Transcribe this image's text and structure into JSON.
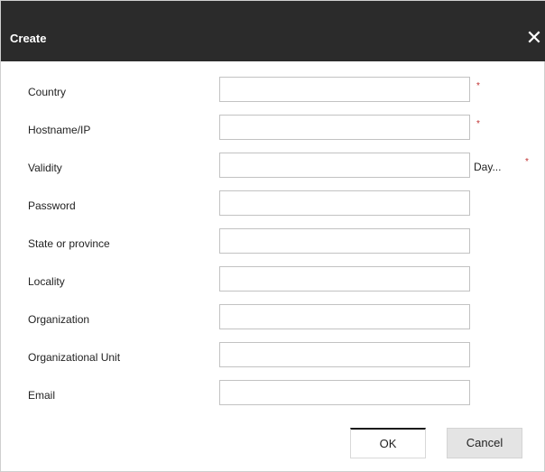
{
  "dialog": {
    "title": "Create",
    "close_glyph": "✕"
  },
  "fields": [
    {
      "label": "Country",
      "value": "",
      "required": true,
      "unit": ""
    },
    {
      "label": "Hostname/IP",
      "value": "",
      "required": true,
      "unit": ""
    },
    {
      "label": "Validity",
      "value": "",
      "required": true,
      "unit": "Day..."
    },
    {
      "label": "Password",
      "value": "",
      "required": false,
      "unit": ""
    },
    {
      "label": "State or province",
      "value": "",
      "required": false,
      "unit": ""
    },
    {
      "label": "Locality",
      "value": "",
      "required": false,
      "unit": ""
    },
    {
      "label": "Organization",
      "value": "",
      "required": false,
      "unit": ""
    },
    {
      "label": "Organizational Unit",
      "value": "",
      "required": false,
      "unit": ""
    },
    {
      "label": "Email",
      "value": "",
      "required": false,
      "unit": ""
    }
  ],
  "required_marker": "*",
  "buttons": {
    "ok": "OK",
    "cancel": "Cancel"
  },
  "colors": {
    "titlebar": "#2b2b2b",
    "required": "#c03030"
  }
}
